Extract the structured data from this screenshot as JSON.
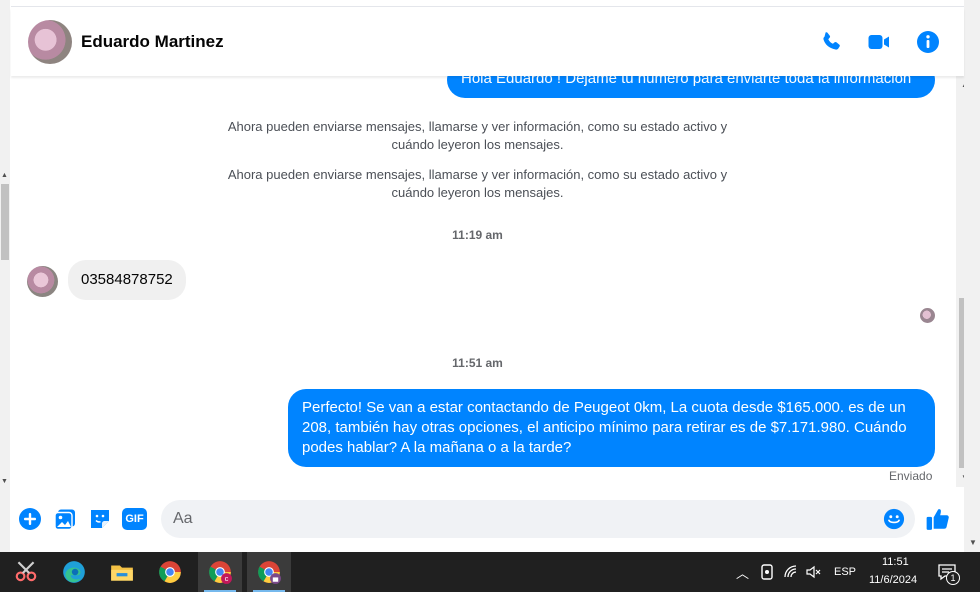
{
  "contact": {
    "name": "Eduardo Martinez"
  },
  "header_icons": [
    "phone-icon",
    "video-icon",
    "info-icon"
  ],
  "messages": {
    "partial_outgoing": "Hola Eduardo ! Dejame tu numero para enviarte toda la información",
    "system_notice_1": "Ahora pueden enviarse mensajes, llamarse y ver información, como su estado activo y cuándo leyeron los mensajes.",
    "system_notice_2": "Ahora pueden enviarse mensajes, llamarse y ver información, como su estado activo y cuándo leyeron los mensajes.",
    "timestamp_1": "11:19 am",
    "incoming_1": "03584878752",
    "timestamp_2": "11:51 am",
    "outgoing_1": "Perfecto!  Se van a estar contactando de Peugeot 0km, La cuota desde $165.000. es de un 208, también hay otras opciones, el anticipo mínimo para retirar es de $7.171.980. Cuándo podes hablar? A la mañana o a la tarde?",
    "delivery_status": "Enviado"
  },
  "composer": {
    "placeholder": "Aa",
    "icons": [
      "plus-icon",
      "gallery-icon",
      "sticker-icon",
      "gif-icon",
      "emoji-icon",
      "like-icon"
    ],
    "gif_label": "GIF"
  },
  "taskbar": {
    "apps": [
      "snipping-tool",
      "edge",
      "file-explorer",
      "chrome",
      "chrome-profile-c",
      "chrome-profile-locked"
    ],
    "language": "ESP",
    "time": "11:51",
    "date": "11/6/2024",
    "notification_count": "1"
  },
  "colors": {
    "accent": "#0084ff",
    "incoming_bubble": "#f0f0f0",
    "taskbar": "#202020"
  }
}
